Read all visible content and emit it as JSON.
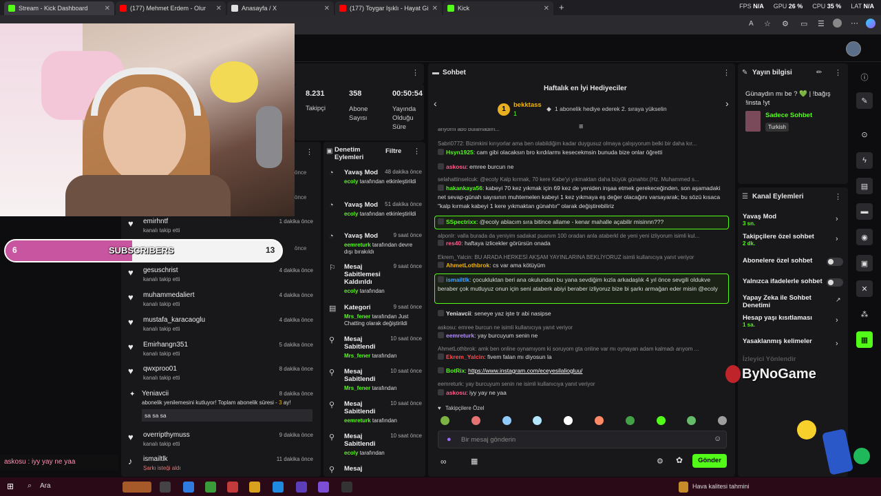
{
  "tabs": [
    {
      "title": "Stream - Kick Dashboard",
      "color": "#53fc18"
    },
    {
      "title": "(177) Mehmet Erdem - Olur",
      "color": "#ff0000"
    },
    {
      "title": "Anasayfa / X",
      "color": "#e0e0e0"
    },
    {
      "title": "(177) Toygar Işıklı - Hayat Gibi (Or",
      "color": "#ff0000"
    },
    {
      "title": "Kick",
      "color": "#53fc18"
    }
  ],
  "tab_close": "✕",
  "new_tab": "+",
  "sysstats": {
    "fps_label": "FPS",
    "fps": "N/A",
    "gpu_label": "GPU",
    "gpu": "26 %",
    "cpu_label": "CPU",
    "cpu": "35 %",
    "lat_label": "LAT",
    "lat": "N/A"
  },
  "stats": {
    "followers": "8.231",
    "followers_label": "Takipçi",
    "subs": "358",
    "subs_label": "Abone Sayısı",
    "uptime": "00:50:54",
    "uptime_label": "Yayında Olduğu Süre"
  },
  "sub_goal": {
    "current": "6",
    "label": "SUBSCRIBERS",
    "target": "13",
    "progress_pct": 46
  },
  "overlay_chat": "askosu : iyy yay ne yaa",
  "followers": [
    {
      "name": "emirhntf",
      "action": "kanalı takip etti",
      "time": "1 dakika önce"
    },
    {
      "name": "gesuschrist",
      "action": "kanalı takip etti",
      "time": "4 dakika önce"
    },
    {
      "name": "muhammedaliert",
      "action": "kanalı takip etti",
      "time": "4 dakika önce"
    },
    {
      "name": "mustafa_karacaoglu",
      "action": "kanalı takip etti",
      "time": "4 dakika önce"
    },
    {
      "name": "Emirhangn351",
      "action": "kanalı takip etti",
      "time": "5 dakika önce"
    },
    {
      "name": "qwxproo01",
      "action": "kanalı takip etti",
      "time": "8 dakika önce"
    }
  ],
  "resub": {
    "name": "Yeniavcii",
    "text": "abonelik yenilemesini kutluyor! Toplam abonelik süresi - ",
    "months": "3",
    "unit": " ay!",
    "time": "8 dakika önce",
    "message": "sa sa sa"
  },
  "followers2": [
    {
      "name": "overripthymuss",
      "action": "kanalı takip etti",
      "time": "9 dakika önce"
    },
    {
      "name": "ismailtlk",
      "action": "Şarkı isteği aldı",
      "time": "11 dakika önce"
    }
  ],
  "hidden_times": [
    "önce",
    "önce",
    "önce"
  ],
  "mod": {
    "title": "Denetim Eylemleri",
    "filter": "Filtre",
    "rows": [
      {
        "title": "Yavaş Mod",
        "time": "48 dakika önce",
        "user": "ecoly",
        "desc": " tarafından etkinleştirildi",
        "icon": "slow"
      },
      {
        "title": "Yavaş Mod",
        "time": "51 dakika önce",
        "user": "ecoly",
        "desc": " tarafından etkinleştirildi",
        "icon": "slow"
      },
      {
        "title": "Yavaş Mod",
        "time": "9 saat önce",
        "user": "eemreturk",
        "desc": " tarafından devre dışı bırakıldı",
        "icon": "slow"
      },
      {
        "title": "Mesaj Sabitlemesi Kaldırıldı",
        "time": "9 saat önce",
        "user": "ecoly",
        "desc": " tarafından",
        "icon": "unpin"
      },
      {
        "title": "Kategori",
        "time": "9 saat önce",
        "user": "Mrs_fener",
        "desc": " tarafından Just Chatting olarak değiştirildi",
        "icon": "cat"
      },
      {
        "title": "Mesaj Sabitlendi",
        "time": "10 saat önce",
        "user": "Mrs_fener",
        "desc": " tarafından",
        "icon": "pin"
      },
      {
        "title": "Mesaj Sabitlendi",
        "time": "10 saat önce",
        "user": "Mrs_fener",
        "desc": " tarafından",
        "icon": "pin"
      },
      {
        "title": "Mesaj Sabitlendi",
        "time": "10 saat önce",
        "user": "eemreturk",
        "desc": " tarafından",
        "icon": "pin"
      },
      {
        "title": "Mesaj Sabitlendi",
        "time": "10 saat önce",
        "user": "ecoly",
        "desc": " tarafından",
        "icon": "pin"
      },
      {
        "title": "Mesaj",
        "time": "",
        "user": "",
        "desc": "",
        "icon": "pin"
      }
    ]
  },
  "chat": {
    "title": "Sohbet",
    "gifter_title": "Haftalık en İyi Hediyeciler",
    "gifter_rank": "1",
    "gifter_name": "bekktass",
    "gifter_count": "1",
    "gifter_hint": "1 abonelik hediye ederek 2. sıraya yükselin",
    "partial_top": "anyorni abo bulamadim...",
    "lines": [
      {
        "type": "sys",
        "text": "Sabri0772: Bizimkini kırıyorlar ama ben olabildiğim kadar duygusuz olmaya çalışıyorum belki bir daha kır..."
      },
      {
        "type": "msg",
        "user": "Hsyn1925",
        "color": "#53fc18",
        "text": "cam gibi olacaksın bro kırdılarmı kesecekmsin bunuda bize onlar öğretti"
      },
      {
        "type": "msg",
        "user": "askosu",
        "color": "#ff5c8a",
        "text": "emree burcun ne"
      },
      {
        "type": "sys",
        "text": "selahattinselcuk: @ecoly Kalp kırmak, 70 kere Kabe'yi yıkmaktan daha büyük günahtır.(Hz. Muhammed s..."
      },
      {
        "type": "msg",
        "user": "hakankaya56",
        "color": "#53fc18",
        "text": "kabeyi 70 kez yıkmak için 69 kez de yeniden inşaa etmek gerekeceğinden, son aşamadaki net sevap-günah sayısının muhtemelen kabeyi 1 kez yıkmaya eş değer olacağını varsayarak; bu sözü kısaca \"kalp kırmak kabeyi 1 kere yıkmaktan günahtır\" olarak değiştirebiliriz"
      },
      {
        "type": "hl",
        "user": "SSpectrixx",
        "color": "#53fc18",
        "text": "@ecoly ablacım sıra bitince allame - kenar mahalle açabilir misinnn???"
      },
      {
        "type": "sys",
        "text": "alponlr: valla burada da yeniyim sadakat puanım 100 oradan anla ataberkl de yeni yeni izliyorum isimli kul..."
      },
      {
        "type": "msg",
        "user": "res40",
        "color": "#ff5c8a",
        "text": "haftaya izlicekler görürsün onada"
      },
      {
        "type": "sys",
        "text": "Ekrem_Yalcin: BU ARADA HERKESİ AKŞAM YAYINLARINA BEKLİYORUZ isimli kullanıcıya yanıt veriyor"
      },
      {
        "type": "msg",
        "user": "AhmetLothbrok",
        "color": "#f4b400",
        "text": "cs var ama kötüyüm"
      },
      {
        "type": "hl",
        "user": "ismailtlk",
        "color": "#4aa3ff",
        "text": "çocukluktan beri ana okulundan bu yana sevdiğim kızla arkadaşlık 4 yıl önce sevgili oldukve beraber çok mutluyuz onun için seni ataberk abiyi beraber izliyoruz bize bi şarkı armağan eder misin @ecoly"
      },
      {
        "type": "msg",
        "user": "Yeniavcii",
        "color": "#e6e6e6",
        "text": "seneye yaz işte tr abi nasipse"
      },
      {
        "type": "sys",
        "text": "askosu: emree burcun ne isimli kullanıcıya yanıt veriyor"
      },
      {
        "type": "msg",
        "user": "eemreturk",
        "color": "#b18cff",
        "text": "yay burcuyum senin ne"
      },
      {
        "type": "sys",
        "text": "AhmetLothbrok: amk ben online oynamıyom ki soruyom gta online var mı oynayan adam kalmadı arıyom ..."
      },
      {
        "type": "msg",
        "user": "Ekrem_Yalcin",
        "color": "#ff4d4d",
        "text": "fivem falan mı diyosun la"
      },
      {
        "type": "msg",
        "user": "BotRix",
        "color": "#53fc18",
        "text": "https://www.instagram.com/eceyesilaliogluu/",
        "link": true
      },
      {
        "type": "sys",
        "text": "eemreturk: yay burcuyum senin ne isimli kullanıcıya yanıt veriyor"
      },
      {
        "type": "msg",
        "user": "askosu",
        "color": "#ff5c8a",
        "text": "iyy yay ne yaa"
      }
    ],
    "emote_tab": "Takipçilere Özel",
    "placeholder": "Bir mesaj gönderin",
    "send": "Gönder"
  },
  "stream_info": {
    "title": "Yayın bilgisi",
    "stream_title": "Günaydın mı be ? 💚 | !bağış !insta !yt",
    "category": "Sadece Sohbet",
    "language": "Turkish"
  },
  "channel_actions": {
    "title": "Kanal Eylemleri",
    "items": [
      {
        "label": "Yavaş Mod",
        "sub": "3 sn.",
        "kind": "chev"
      },
      {
        "label": "Takipçilere özel sohbet",
        "sub": "2 dk.",
        "kind": "chev"
      },
      {
        "label": "Abonelere özel sohbet",
        "sub": "",
        "kind": "toggle"
      },
      {
        "label": "Yalnızca ifadelerle sohbet",
        "sub": "",
        "kind": "toggle"
      },
      {
        "label": "Yapay Zeka ile Sohbet Denetimi",
        "sub": "",
        "kind": "ext"
      },
      {
        "label": "Hesap yaşı kısıtlaması",
        "sub": "1 sa.",
        "kind": "chev"
      },
      {
        "label": "Yasaklanmış kelimeler",
        "sub": "",
        "kind": "chev"
      },
      {
        "label": "İzleyici Yönlendir",
        "sub": "",
        "kind": "none"
      }
    ]
  },
  "watermark": "ByNoGame",
  "taskbar": {
    "search": "Ara",
    "weather": "Hava kalitesi tahmini"
  },
  "colors": {
    "accent": "#53fc18",
    "panel": "#18181b",
    "bg": "#0d0d0f"
  }
}
